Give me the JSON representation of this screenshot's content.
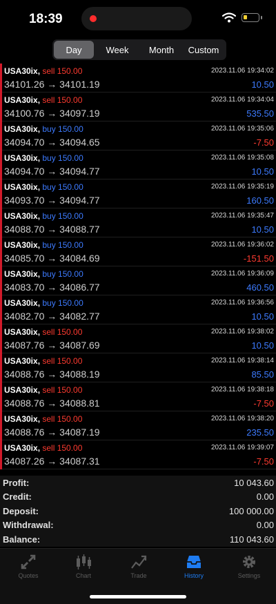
{
  "status": {
    "time": "18:39"
  },
  "period_tabs": [
    "Day",
    "Week",
    "Month",
    "Custom"
  ],
  "active_period": "Day",
  "deals": [
    {
      "symbol": "USA30ix,",
      "side": "sell",
      "volume": "150.00",
      "price_open": "34101.26",
      "price_close": "34101.19",
      "datetime": "2023.11.06 19:34:02",
      "profit": "10.50",
      "sign": "pos"
    },
    {
      "symbol": "USA30ix,",
      "side": "sell",
      "volume": "150.00",
      "price_open": "34100.76",
      "price_close": "34097.19",
      "datetime": "2023.11.06 19:34:04",
      "profit": "535.50",
      "sign": "pos"
    },
    {
      "symbol": "USA30ix,",
      "side": "buy",
      "volume": "150.00",
      "price_open": "34094.70",
      "price_close": "34094.65",
      "datetime": "2023.11.06 19:35:06",
      "profit": "-7.50",
      "sign": "neg"
    },
    {
      "symbol": "USA30ix,",
      "side": "buy",
      "volume": "150.00",
      "price_open": "34094.70",
      "price_close": "34094.77",
      "datetime": "2023.11.06 19:35:08",
      "profit": "10.50",
      "sign": "pos"
    },
    {
      "symbol": "USA30ix,",
      "side": "buy",
      "volume": "150.00",
      "price_open": "34093.70",
      "price_close": "34094.77",
      "datetime": "2023.11.06 19:35:19",
      "profit": "160.50",
      "sign": "pos"
    },
    {
      "symbol": "USA30ix,",
      "side": "buy",
      "volume": "150.00",
      "price_open": "34088.70",
      "price_close": "34088.77",
      "datetime": "2023.11.06 19:35:47",
      "profit": "10.50",
      "sign": "pos"
    },
    {
      "symbol": "USA30ix,",
      "side": "buy",
      "volume": "150.00",
      "price_open": "34085.70",
      "price_close": "34084.69",
      "datetime": "2023.11.06 19:36:02",
      "profit": "-151.50",
      "sign": "neg"
    },
    {
      "symbol": "USA30ix,",
      "side": "buy",
      "volume": "150.00",
      "price_open": "34083.70",
      "price_close": "34086.77",
      "datetime": "2023.11.06 19:36:09",
      "profit": "460.50",
      "sign": "pos"
    },
    {
      "symbol": "USA30ix,",
      "side": "buy",
      "volume": "150.00",
      "price_open": "34082.70",
      "price_close": "34082.77",
      "datetime": "2023.11.06 19:36:56",
      "profit": "10.50",
      "sign": "pos"
    },
    {
      "symbol": "USA30ix,",
      "side": "sell",
      "volume": "150.00",
      "price_open": "34087.76",
      "price_close": "34087.69",
      "datetime": "2023.11.06 19:38:02",
      "profit": "10.50",
      "sign": "pos"
    },
    {
      "symbol": "USA30ix,",
      "side": "sell",
      "volume": "150.00",
      "price_open": "34088.76",
      "price_close": "34088.19",
      "datetime": "2023.11.06 19:38:14",
      "profit": "85.50",
      "sign": "pos"
    },
    {
      "symbol": "USA30ix,",
      "side": "sell",
      "volume": "150.00",
      "price_open": "34088.76",
      "price_close": "34088.81",
      "datetime": "2023.11.06 19:38:18",
      "profit": "-7.50",
      "sign": "neg"
    },
    {
      "symbol": "USA30ix,",
      "side": "sell",
      "volume": "150.00",
      "price_open": "34088.76",
      "price_close": "34087.19",
      "datetime": "2023.11.06 19:38:20",
      "profit": "235.50",
      "sign": "pos"
    },
    {
      "symbol": "USA30ix,",
      "side": "sell",
      "volume": "150.00",
      "price_open": "34087.26",
      "price_close": "34087.31",
      "datetime": "2023.11.06 19:39:07",
      "profit": "-7.50",
      "sign": "neg"
    }
  ],
  "arrow": "→",
  "summary": [
    {
      "label": "Profit:",
      "value": "10 043.60"
    },
    {
      "label": "Credit:",
      "value": "0.00"
    },
    {
      "label": "Deposit:",
      "value": "100 000.00"
    },
    {
      "label": "Withdrawal:",
      "value": "0.00"
    },
    {
      "label": "Balance:",
      "value": "110 043.60"
    }
  ],
  "tabbar": [
    {
      "label": "Quotes",
      "icon": "quotes-icon"
    },
    {
      "label": "Chart",
      "icon": "chart-icon"
    },
    {
      "label": "Trade",
      "icon": "trade-icon"
    },
    {
      "label": "History",
      "icon": "history-icon"
    },
    {
      "label": "Settings",
      "icon": "settings-icon"
    }
  ],
  "active_tab": "History",
  "colors": {
    "sell": "#ff3b30",
    "buy": "#3d7bff",
    "accent": "#1e7cf2",
    "marker": "#d11a2a"
  }
}
